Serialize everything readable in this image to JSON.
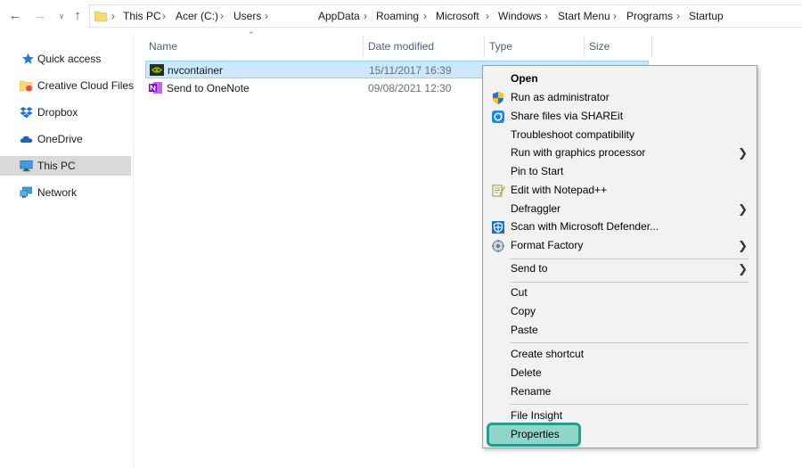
{
  "nav": {
    "back_icon": "arrow-left-icon",
    "forward_icon": "arrow-right-icon",
    "recent_icon": "chevron-down-icon",
    "up_icon": "arrow-up-icon"
  },
  "breadcrumb": [
    "This PC",
    "Acer (C:)",
    "Users",
    "AppData",
    "Roaming",
    "Microsoft",
    "Windows",
    "Start Menu",
    "Programs",
    "Startup"
  ],
  "sidebar": {
    "items": [
      {
        "label": "Quick access",
        "icon": "star-icon"
      },
      {
        "label": "Creative Cloud Files",
        "icon": "creative-cloud-folder-icon"
      },
      {
        "label": "Dropbox",
        "icon": "dropbox-icon"
      },
      {
        "label": "OneDrive",
        "icon": "onedrive-cloud-icon"
      },
      {
        "label": "This PC",
        "icon": "computer-icon",
        "selected": true
      },
      {
        "label": "Network",
        "icon": "network-icon"
      }
    ]
  },
  "columns": {
    "name": "Name",
    "date": "Date modified",
    "type": "Type",
    "size": "Size"
  },
  "files": [
    {
      "name": "nvcontainer",
      "date": "15/11/2017 16:39",
      "icon": "nvidia-icon",
      "selected": true
    },
    {
      "name": "Send to OneNote",
      "date": "09/08/2021 12:30",
      "icon": "onenote-icon"
    }
  ],
  "context_menu": {
    "items": [
      {
        "label": "Open",
        "bold": true
      },
      {
        "label": "Run as administrator",
        "icon": "uac-shield-icon"
      },
      {
        "label": "Share files via SHAREit",
        "icon": "shareit-icon"
      },
      {
        "label": "Troubleshoot compatibility"
      },
      {
        "label": "Run with graphics processor",
        "submenu": true
      },
      {
        "label": "Pin to Start"
      },
      {
        "label": "Edit with Notepad++",
        "icon": "notepadpp-icon"
      },
      {
        "label": "Defraggler",
        "submenu": true
      },
      {
        "label": "Scan with Microsoft Defender...",
        "icon": "defender-icon"
      },
      {
        "label": "Format Factory",
        "icon": "format-factory-icon",
        "submenu": true
      },
      {
        "label": "Send to",
        "submenu": true
      },
      {
        "label": "Cut"
      },
      {
        "label": "Copy"
      },
      {
        "label": "Paste"
      },
      {
        "label": "Create shortcut"
      },
      {
        "label": "Delete"
      },
      {
        "label": "Rename"
      },
      {
        "label": "File Insight"
      },
      {
        "label": "Properties",
        "highlighted": true
      }
    ]
  },
  "colors": {
    "selection": "#cce8ff",
    "highlight_fill": "#8fd5c9",
    "highlight_border": "#1f9e8e",
    "menu_bg": "#f2f2f2"
  }
}
